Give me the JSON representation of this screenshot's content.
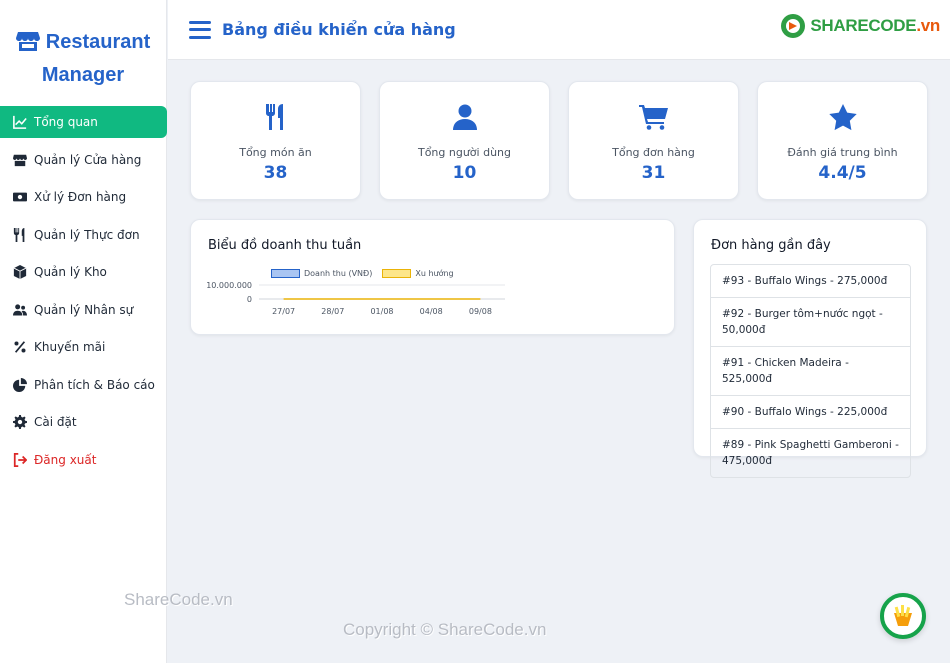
{
  "brand": {
    "line1": "Restaurant",
    "line2": "Manager",
    "icon": "store-icon"
  },
  "sidebar": {
    "items": [
      {
        "label": "Tổng quan",
        "icon": "chart-line-icon",
        "active": true
      },
      {
        "label": "Quản lý Cửa hàng",
        "icon": "store-icon"
      },
      {
        "label": "Xử lý Đơn hàng",
        "icon": "money-bill-icon"
      },
      {
        "label": "Quản lý Thực đơn",
        "icon": "utensils-icon"
      },
      {
        "label": "Quản lý Kho",
        "icon": "box-icon"
      },
      {
        "label": "Quản lý Nhân sự",
        "icon": "users-icon"
      },
      {
        "label": "Khuyến mãi",
        "icon": "percent-icon"
      },
      {
        "label": "Phân tích & Báo cáo",
        "icon": "pie-chart-icon"
      },
      {
        "label": "Cài đặt",
        "icon": "gear-icon"
      },
      {
        "label": "Đăng xuất",
        "icon": "logout-icon"
      }
    ]
  },
  "header": {
    "title": "Bảng điều khiển cửa hàng",
    "logo_part1": "SHARE",
    "logo_part2": "CODE",
    "logo_part3": ".vn"
  },
  "stats": [
    {
      "label": "Tổng món ăn",
      "value": "38",
      "icon": "utensils-icon"
    },
    {
      "label": "Tổng người dùng",
      "value": "10",
      "icon": "user-icon"
    },
    {
      "label": "Tổng đơn hàng",
      "value": "31",
      "icon": "cart-icon"
    },
    {
      "label": "Đánh giá trung bình",
      "value": "4.4/5",
      "icon": "star-icon"
    }
  ],
  "chart_title": "Biểu đồ doanh thu tuần",
  "chart_data": {
    "type": "bar",
    "title": "Biểu đồ doanh thu tuần",
    "categories": [
      "27/07",
      "28/07",
      "01/08",
      "04/08",
      "09/08"
    ],
    "series": [
      {
        "name": "Doanh thu (VNĐ)",
        "type": "bar",
        "color": "#a9c5f2",
        "border": "#2563c9",
        "values": [
          0,
          0,
          0,
          0,
          0
        ]
      },
      {
        "name": "Xu hướng",
        "type": "line",
        "color": "#fde68a",
        "border": "#eab308",
        "values": [
          0,
          0,
          0,
          0,
          0
        ]
      }
    ],
    "y_ticks": [
      "10.000.000",
      "0"
    ],
    "ylim": [
      0,
      10000000
    ],
    "grid": true,
    "legend": "top"
  },
  "orders": {
    "title": "Đơn hàng gần đây",
    "items": [
      "#93 - Buffalo Wings - 275,000đ",
      "#92 - Burger tôm+nước ngọt - 50,000đ",
      "#91 - Chicken Madeira - 525,000đ",
      "#90 - Buffalo Wings - 225,000đ",
      "#89 - Pink Spaghetti Gamberoni - 475,000đ"
    ]
  },
  "watermark": {
    "text1": "ShareCode.vn",
    "text2": "Copyright © ShareCode.vn"
  },
  "colors": {
    "primary": "#2563c9",
    "active": "#10b981",
    "danger": "#dc2626"
  }
}
